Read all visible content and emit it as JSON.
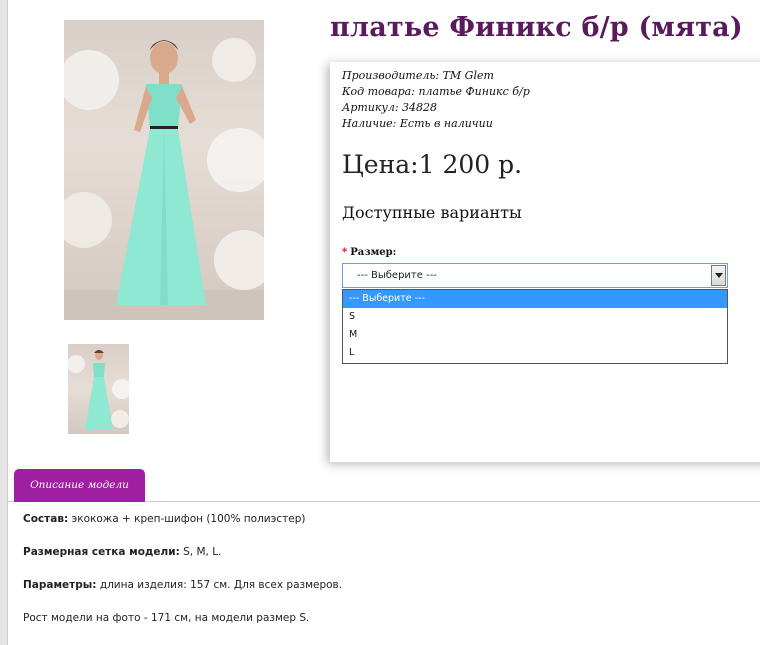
{
  "product": {
    "title": "платье Финикс б/р (мята)",
    "meta": [
      {
        "key": "Производитель:",
        "value": "ТМ Glem"
      },
      {
        "key": "Код товара:",
        "value": "платье Финикс б/р"
      },
      {
        "key": "Артикул:",
        "value": "34828"
      },
      {
        "key": "Наличие:",
        "value": "Есть в наличии"
      }
    ],
    "price": "Цена:1 200 р."
  },
  "options": {
    "title": "Доступные варианты",
    "required_mark": "*",
    "size_label": "Размер:",
    "selected": "--- Выберите ---",
    "items": [
      "--- Выберите ---",
      "S",
      "M",
      "L"
    ]
  },
  "tabs": [
    {
      "label": "Описание модели"
    }
  ],
  "description": [
    {
      "key": "Состав:",
      "value": "экокожа + креп-шифон (100% полиэстер)"
    },
    {
      "key": "Размерная сетка модели:",
      "value": "S, M, L."
    },
    {
      "key": "Параметры:",
      "value": "длина изделия: 157 см. Для всех размеров."
    },
    {
      "key": "",
      "value": "Рост модели на фото - 171 см, на модели размер S."
    }
  ],
  "colors": {
    "title": "#5b1a5e",
    "tab": "#a01ea0",
    "dress": "#7fe0c7",
    "highlight": "#3399ff"
  },
  "icons": {
    "dropdown": "chevron-down-icon"
  }
}
